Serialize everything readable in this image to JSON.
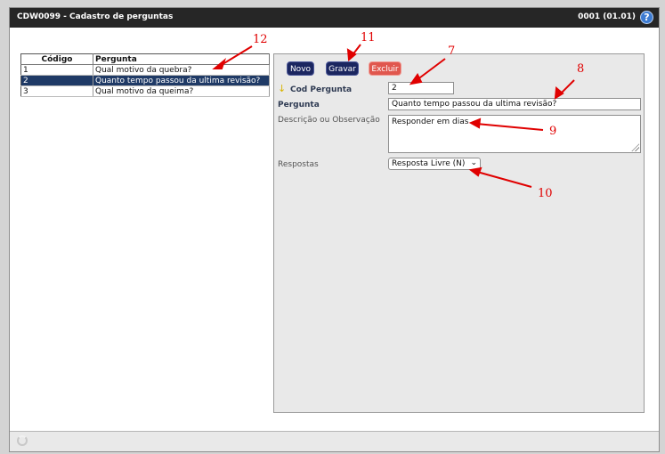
{
  "window": {
    "title": "CDW0099 - Cadastro de perguntas",
    "code": "0001 (01.01)",
    "help_glyph": "?"
  },
  "grid": {
    "headers": [
      "Código",
      "Pergunta"
    ],
    "rows": [
      {
        "codigo": "1",
        "pergunta": "Qual motivo da quebra?"
      },
      {
        "codigo": "2",
        "pergunta": "Quanto tempo passou da ultima revisão?"
      },
      {
        "codigo": "3",
        "pergunta": "Qual motivo da queima?"
      }
    ],
    "selected_row": "2"
  },
  "toolbar": {
    "novo": "Novo",
    "gravar": "Gravar",
    "excluir": "Excluir"
  },
  "form": {
    "cod_label": "Cod Pergunta",
    "cod_value": "2",
    "pergunta_label": "Pergunta",
    "pergunta_value": "Quanto tempo passou da ultima revisão?",
    "descricao_label": "Descrição ou Observação",
    "descricao_value": "Responder em dias",
    "respostas_label": "Respostas",
    "respostas_value": "Resposta Livre (N)"
  },
  "annotations": [
    "12",
    "11",
    "7",
    "8",
    "9",
    "10"
  ],
  "colors": {
    "titlebar": "#262626",
    "accent": "#1b2660",
    "danger": "#e0574e",
    "annotation": "#e00000"
  }
}
